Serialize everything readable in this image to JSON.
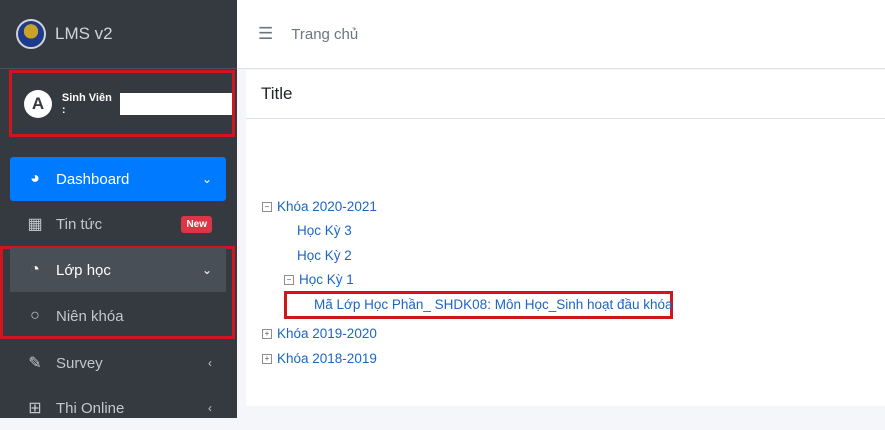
{
  "sidebar": {
    "brand": "LMS v2",
    "user_label": "Sinh Viên :",
    "avatar_letter": "A",
    "items": [
      {
        "label": "Dashboard",
        "icon": "dashboard-icon",
        "arrow": "⌄"
      },
      {
        "label": "Tin tức",
        "icon": "grid-icon",
        "badge": "New"
      },
      {
        "label": "Lớp học",
        "icon": "pie-chart-icon",
        "arrow": "⌄"
      },
      {
        "label": "Niên khóa",
        "icon": "circle-icon"
      },
      {
        "label": "Survey",
        "icon": "edit-icon",
        "arrow": "‹"
      },
      {
        "label": "Thi Online",
        "icon": "table-icon",
        "arrow": "‹"
      }
    ]
  },
  "header": {
    "menu_icon": "hamburger-icon",
    "breadcrumb": "Trang chủ"
  },
  "card": {
    "title": "Title"
  },
  "tree": {
    "year1": {
      "label": "Khóa 2020-2021",
      "toggle": "−"
    },
    "hk3": "Học Kỳ 3",
    "hk2": "Học Kỳ 2",
    "hk1": {
      "label": "Học Kỳ 1",
      "toggle": "−"
    },
    "course": "Mã Lớp Học Phần_ SHDK08: Môn Học_Sinh hoạt đầu khóa",
    "year2": {
      "label": "Khóa 2019-2020",
      "toggle": "+"
    },
    "year3": {
      "label": "Khóa 2018-2019",
      "toggle": "+"
    }
  },
  "colors": {
    "accent": "#007bff",
    "sidebar": "#343a40",
    "highlight_border": "#d0161c",
    "link": "#1a66c4",
    "badge": "#dc3545"
  }
}
